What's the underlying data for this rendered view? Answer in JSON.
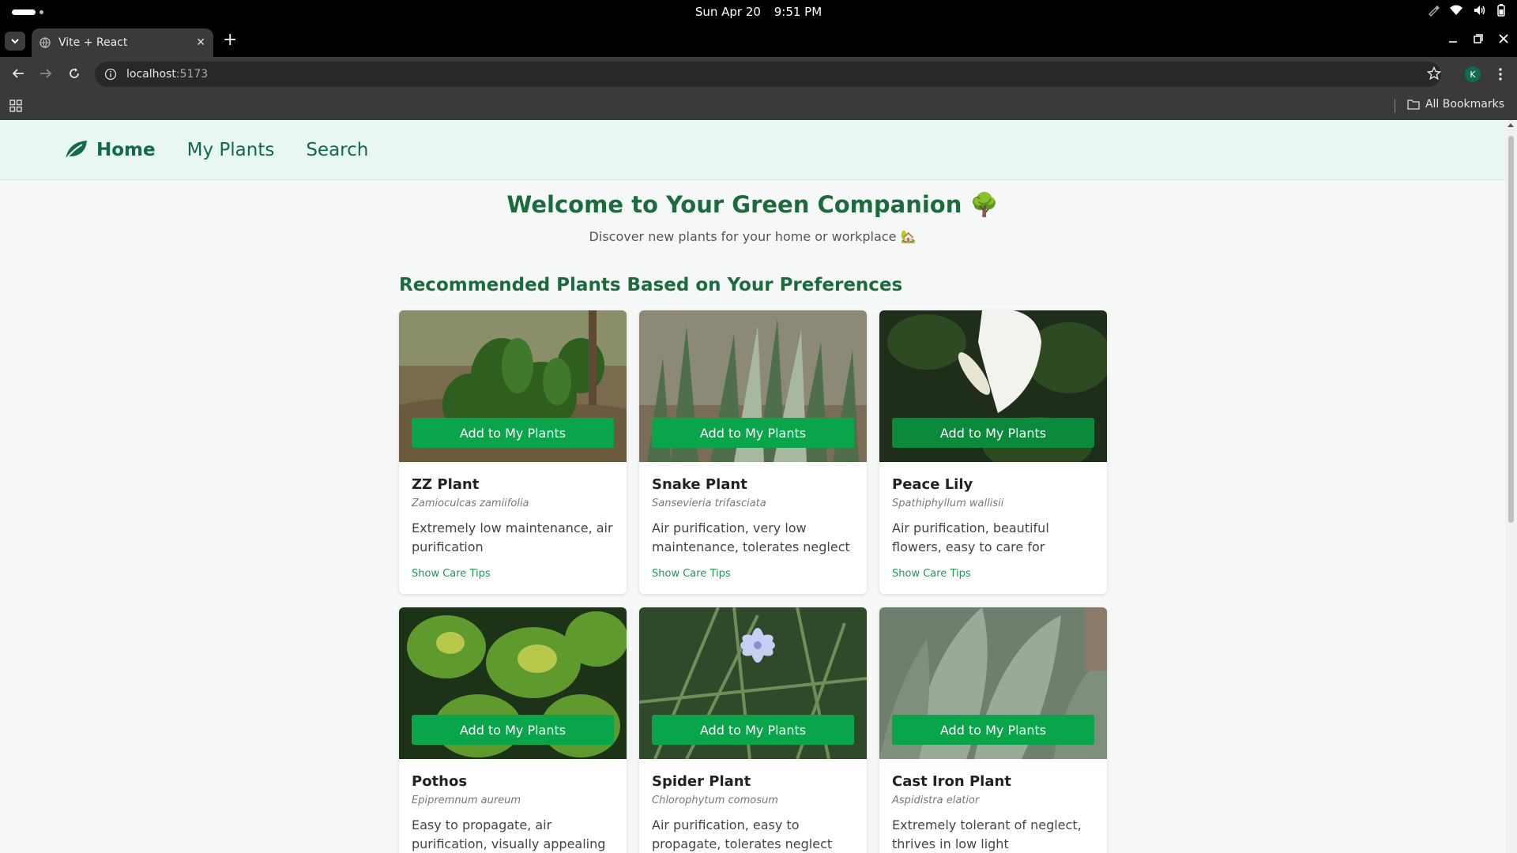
{
  "os": {
    "date": "Sun Apr 20",
    "time": "9:51 PM"
  },
  "browser": {
    "tab_title": "Vite + React",
    "url_host": "localhost",
    "url_port": ":5173",
    "bookmarks_label": "All Bookmarks",
    "profile_initial": "K"
  },
  "nav": {
    "home": "Home",
    "my_plants": "My Plants",
    "search": "Search"
  },
  "hero": {
    "title": "Welcome to Your Green Companion 🌳",
    "subtitle": "Discover new plants for your home or workplace 🏡"
  },
  "section_title": "Recommended Plants Based on Your Preferences",
  "add_label": "Add to My Plants",
  "care_label": "Show Care Tips",
  "plants": [
    {
      "name": "ZZ Plant",
      "scientific": "Zamioculcas zamiifolia",
      "description": "Extremely low maintenance, air purification"
    },
    {
      "name": "Snake Plant",
      "scientific": "Sansevieria trifasciata",
      "description": "Air purification, very low maintenance, tolerates neglect"
    },
    {
      "name": "Peace Lily",
      "scientific": "Spathiphyllum wallisii",
      "description": "Air purification, beautiful flowers, easy to care for"
    },
    {
      "name": "Pothos",
      "scientific": "Epipremnum aureum",
      "description": "Easy to propagate, air purification, visually appealing"
    },
    {
      "name": "Spider Plant",
      "scientific": "Chlorophytum comosum",
      "description": "Air purification, easy to propagate, tolerates neglect"
    },
    {
      "name": "Cast Iron Plant",
      "scientific": "Aspidistra elatior",
      "description": "Extremely tolerant of neglect, thrives in low light"
    }
  ],
  "colors": {
    "nav_bg": "#e8f8f0",
    "brand_green": "#1c6b3c",
    "button_green": "#0aa54a",
    "link_green": "#14a14c"
  }
}
